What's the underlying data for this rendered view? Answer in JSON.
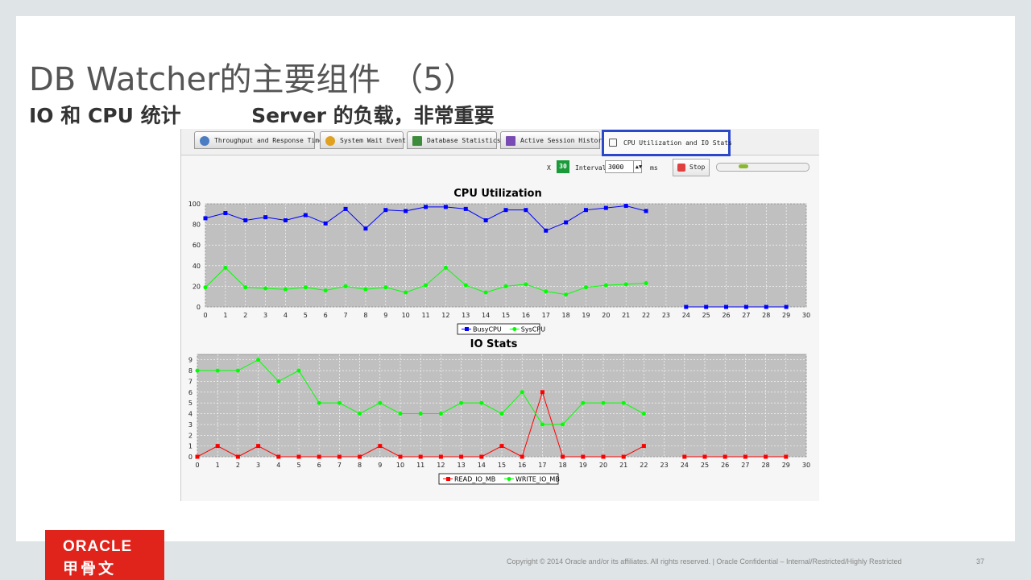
{
  "slide": {
    "title": "DB Watcher的主要组件 （5）",
    "subtitle_left": "IO 和 CPU 统计",
    "subtitle_right": "Server 的负载，非常重要"
  },
  "tabs": [
    {
      "label": "Throughput and Response Time",
      "icon": "gauge-icon",
      "color": "#4a7cc4"
    },
    {
      "label": "System Wait Event",
      "icon": "pie-icon",
      "color": "#e0a020"
    },
    {
      "label": "Database Statistics",
      "icon": "bar-chart-icon",
      "color": "#3c8c3c"
    },
    {
      "label": "Active Session History",
      "icon": "chart-icon",
      "color": "#7a4ab4"
    },
    {
      "label": "CPU Utilization and IO Stats",
      "icon": "monitor-icon",
      "color": "#555555",
      "active": true
    }
  ],
  "toolbar": {
    "x_label": "X",
    "count": "30",
    "interval_label": "Interval",
    "interval_value": "3000",
    "unit": "ms",
    "stop_label": "Stop",
    "progress": 0.25
  },
  "colors": {
    "plot_bg": "#c0c0c0",
    "busy": "#0000ff",
    "sys": "#00ff00",
    "read": "#ff0000",
    "write": "#00ff00"
  },
  "chart_data": [
    {
      "type": "line",
      "title": "CPU Utilization",
      "x": [
        0,
        1,
        2,
        3,
        4,
        5,
        6,
        7,
        8,
        9,
        10,
        11,
        12,
        13,
        14,
        15,
        16,
        17,
        18,
        19,
        20,
        21,
        22,
        23,
        24,
        25,
        26,
        27,
        28,
        29,
        30
      ],
      "xticks": [
        "0",
        "1",
        "2",
        "3",
        "4",
        "5",
        "6",
        "7",
        "8",
        "9",
        "10",
        "11",
        "12",
        "13",
        "14",
        "15",
        "16",
        "17",
        "18",
        "19",
        "20",
        "21",
        "22",
        "23",
        "24",
        "25",
        "26",
        "27",
        "28",
        "29",
        "30"
      ],
      "yticks": [
        "0",
        "20",
        "40",
        "60",
        "80",
        "100"
      ],
      "xlim": [
        0,
        30
      ],
      "ylim": [
        0,
        100
      ],
      "grid": true,
      "legend": "bottom-center",
      "series": [
        {
          "name": "BusyCPU",
          "x": [
            0,
            1,
            2,
            3,
            4,
            5,
            6,
            7,
            8,
            9,
            10,
            11,
            12,
            13,
            14,
            15,
            16,
            17,
            18,
            19,
            20,
            21,
            22,
            24,
            25,
            26,
            27,
            28,
            29
          ],
          "values": [
            86,
            91,
            84,
            87,
            84,
            89,
            81,
            95,
            76,
            94,
            93,
            97,
            97,
            95,
            84,
            94,
            94,
            74,
            82,
            94,
            96,
            98,
            93,
            0,
            0,
            0,
            0,
            0,
            0
          ]
        },
        {
          "name": "SysCPU",
          "x": [
            0,
            1,
            2,
            3,
            4,
            5,
            6,
            7,
            8,
            9,
            10,
            11,
            12,
            13,
            14,
            15,
            16,
            17,
            18,
            19,
            20,
            21,
            22
          ],
          "values": [
            19,
            38,
            19,
            18,
            17,
            19,
            16,
            20,
            17,
            19,
            14,
            21,
            38,
            21,
            14,
            20,
            22,
            15,
            12,
            19,
            21,
            22,
            23
          ]
        }
      ]
    },
    {
      "type": "line",
      "title": "IO Stats",
      "x": [
        0,
        1,
        2,
        3,
        4,
        5,
        6,
        7,
        8,
        9,
        10,
        11,
        12,
        13,
        14,
        15,
        16,
        17,
        18,
        19,
        20,
        21,
        22,
        23,
        24,
        25,
        26,
        27,
        28,
        29,
        30
      ],
      "xticks": [
        "0",
        "1",
        "2",
        "3",
        "4",
        "5",
        "6",
        "7",
        "8",
        "9",
        "10",
        "11",
        "12",
        "13",
        "14",
        "15",
        "16",
        "17",
        "18",
        "19",
        "20",
        "21",
        "22",
        "23",
        "24",
        "25",
        "26",
        "27",
        "28",
        "29",
        "30"
      ],
      "yticks": [
        "0",
        "1",
        "2",
        "3",
        "4",
        "5",
        "6",
        "7",
        "8",
        "9"
      ],
      "xlim": [
        0,
        30
      ],
      "ylim": [
        0,
        9.5
      ],
      "grid": true,
      "legend": "bottom-center",
      "series": [
        {
          "name": "READ_IO_MB",
          "x": [
            0,
            1,
            2,
            3,
            4,
            5,
            6,
            7,
            8,
            9,
            10,
            11,
            12,
            13,
            14,
            15,
            16,
            17,
            18,
            19,
            20,
            21,
            22,
            24,
            25,
            26,
            27,
            28,
            29
          ],
          "values": [
            0,
            1,
            0,
            1,
            0,
            0,
            0,
            0,
            0,
            1,
            0,
            0,
            0,
            0,
            0,
            1,
            0,
            6,
            0,
            0,
            0,
            0,
            1,
            0,
            0,
            0,
            0,
            0,
            0
          ]
        },
        {
          "name": "WRITE_IO_MB",
          "x": [
            0,
            1,
            2,
            3,
            4,
            5,
            6,
            7,
            8,
            9,
            10,
            11,
            12,
            13,
            14,
            15,
            16,
            17,
            18,
            19,
            20,
            21,
            22
          ],
          "values": [
            8,
            8,
            8,
            9,
            7,
            8,
            5,
            5,
            4,
            5,
            4,
            4,
            4,
            5,
            5,
            4,
            6,
            3,
            3,
            5,
            5,
            5,
            4
          ]
        }
      ]
    }
  ],
  "footer": {
    "brand": "ORACLE",
    "brand_cn": "甲骨文",
    "copyright": "Copyright © 2014 Oracle and/or its affiliates. All rights reserved.  |  Oracle Confidential – Internal/Restricted/Highly Restricted",
    "page": "37"
  }
}
